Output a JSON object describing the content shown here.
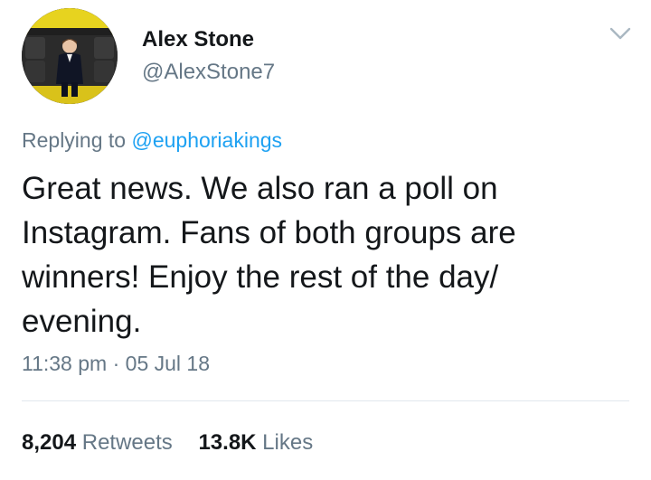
{
  "author": {
    "name": "Alex Stone",
    "handle": "@AlexStone7"
  },
  "reply": {
    "prefix": "Replying to",
    "mention": "@euphoriakings"
  },
  "tweet": {
    "text": "Great news. We also ran a poll on Instagram. Fans of both groups are winners! Enjoy the rest of the day/ evening.",
    "time": "11:38 pm",
    "separator": "·",
    "date": "05 Jul 18"
  },
  "stats": {
    "retweets_count": "8,204",
    "retweets_label": "Retweets",
    "likes_count": "13.8K",
    "likes_label": "Likes"
  },
  "icons": {
    "menu": "chevron-down-icon"
  },
  "colors": {
    "text": "#14171a",
    "secondary": "#657786",
    "link": "#1da1f2",
    "divider": "#e1e8ed"
  }
}
